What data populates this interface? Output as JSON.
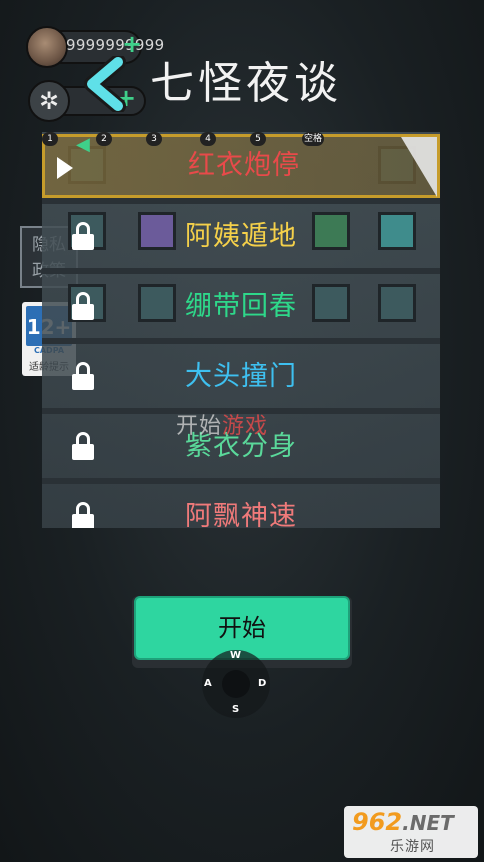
{
  "hud": {
    "coins": "9999999999",
    "coin_plus": "+",
    "gear_plus": "+"
  },
  "header": {
    "title": "七怪夜谈"
  },
  "side": {
    "privacy_label": "隐私政策",
    "age_rating": "12+",
    "age_org": "CADPA",
    "age_tip": "适龄提示"
  },
  "key_hints": [
    "1",
    "2",
    "3",
    "4",
    "5",
    "空格"
  ],
  "levels": [
    {
      "label": "红衣炮停",
      "color": "#e84a4a",
      "locked": false,
      "selected": true
    },
    {
      "label": "阿姨遁地",
      "color": "#f4d04a",
      "locked": true,
      "selected": false
    },
    {
      "label": "绷带回春",
      "color": "#2ed88a",
      "locked": true,
      "selected": false
    },
    {
      "label": "大头撞门",
      "color": "#3ec0f0",
      "locked": true,
      "selected": false
    },
    {
      "label": "紫衣分身",
      "color": "#5ad89a",
      "locked": true,
      "selected": false
    },
    {
      "label": "阿飘神速",
      "color": "#f07a7a",
      "locked": true,
      "selected": false
    }
  ],
  "background_text": {
    "start_white": "开始",
    "start_red": "游戏"
  },
  "start_button": {
    "label": "开始"
  },
  "dpad": {
    "up": "W",
    "left": "A",
    "right": "D",
    "down": "S"
  },
  "watermark": {
    "brand": "962",
    "domain": ".NET",
    "site": "乐游网"
  },
  "colors": {
    "accent_green": "#2ed6a0",
    "selected_border": "#c69c2b"
  }
}
